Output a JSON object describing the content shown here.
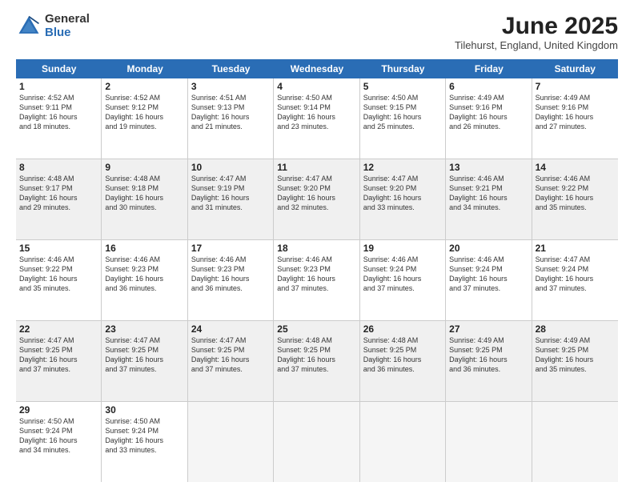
{
  "header": {
    "logo_general": "General",
    "logo_blue": "Blue",
    "month_title": "June 2025",
    "location": "Tilehurst, England, United Kingdom"
  },
  "days_of_week": [
    "Sunday",
    "Monday",
    "Tuesday",
    "Wednesday",
    "Thursday",
    "Friday",
    "Saturday"
  ],
  "rows": [
    [
      {
        "day": "1",
        "sunrise": "4:52 AM",
        "sunset": "9:11 PM",
        "daylight": "16 hours and 18 minutes."
      },
      {
        "day": "2",
        "sunrise": "4:52 AM",
        "sunset": "9:12 PM",
        "daylight": "16 hours and 19 minutes."
      },
      {
        "day": "3",
        "sunrise": "4:51 AM",
        "sunset": "9:13 PM",
        "daylight": "16 hours and 21 minutes."
      },
      {
        "day": "4",
        "sunrise": "4:50 AM",
        "sunset": "9:14 PM",
        "daylight": "16 hours and 23 minutes."
      },
      {
        "day": "5",
        "sunrise": "4:50 AM",
        "sunset": "9:15 PM",
        "daylight": "16 hours and 25 minutes."
      },
      {
        "day": "6",
        "sunrise": "4:49 AM",
        "sunset": "9:16 PM",
        "daylight": "16 hours and 26 minutes."
      },
      {
        "day": "7",
        "sunrise": "4:49 AM",
        "sunset": "9:16 PM",
        "daylight": "16 hours and 27 minutes."
      }
    ],
    [
      {
        "day": "8",
        "sunrise": "4:48 AM",
        "sunset": "9:17 PM",
        "daylight": "16 hours and 29 minutes."
      },
      {
        "day": "9",
        "sunrise": "4:48 AM",
        "sunset": "9:18 PM",
        "daylight": "16 hours and 30 minutes."
      },
      {
        "day": "10",
        "sunrise": "4:47 AM",
        "sunset": "9:19 PM",
        "daylight": "16 hours and 31 minutes."
      },
      {
        "day": "11",
        "sunrise": "4:47 AM",
        "sunset": "9:20 PM",
        "daylight": "16 hours and 32 minutes."
      },
      {
        "day": "12",
        "sunrise": "4:47 AM",
        "sunset": "9:20 PM",
        "daylight": "16 hours and 33 minutes."
      },
      {
        "day": "13",
        "sunrise": "4:46 AM",
        "sunset": "9:21 PM",
        "daylight": "16 hours and 34 minutes."
      },
      {
        "day": "14",
        "sunrise": "4:46 AM",
        "sunset": "9:22 PM",
        "daylight": "16 hours and 35 minutes."
      }
    ],
    [
      {
        "day": "15",
        "sunrise": "4:46 AM",
        "sunset": "9:22 PM",
        "daylight": "16 hours and 35 minutes."
      },
      {
        "day": "16",
        "sunrise": "4:46 AM",
        "sunset": "9:23 PM",
        "daylight": "16 hours and 36 minutes."
      },
      {
        "day": "17",
        "sunrise": "4:46 AM",
        "sunset": "9:23 PM",
        "daylight": "16 hours and 36 minutes."
      },
      {
        "day": "18",
        "sunrise": "4:46 AM",
        "sunset": "9:23 PM",
        "daylight": "16 hours and 37 minutes."
      },
      {
        "day": "19",
        "sunrise": "4:46 AM",
        "sunset": "9:24 PM",
        "daylight": "16 hours and 37 minutes."
      },
      {
        "day": "20",
        "sunrise": "4:46 AM",
        "sunset": "9:24 PM",
        "daylight": "16 hours and 37 minutes."
      },
      {
        "day": "21",
        "sunrise": "4:47 AM",
        "sunset": "9:24 PM",
        "daylight": "16 hours and 37 minutes."
      }
    ],
    [
      {
        "day": "22",
        "sunrise": "4:47 AM",
        "sunset": "9:25 PM",
        "daylight": "16 hours and 37 minutes."
      },
      {
        "day": "23",
        "sunrise": "4:47 AM",
        "sunset": "9:25 PM",
        "daylight": "16 hours and 37 minutes."
      },
      {
        "day": "24",
        "sunrise": "4:47 AM",
        "sunset": "9:25 PM",
        "daylight": "16 hours and 37 minutes."
      },
      {
        "day": "25",
        "sunrise": "4:48 AM",
        "sunset": "9:25 PM",
        "daylight": "16 hours and 37 minutes."
      },
      {
        "day": "26",
        "sunrise": "4:48 AM",
        "sunset": "9:25 PM",
        "daylight": "16 hours and 36 minutes."
      },
      {
        "day": "27",
        "sunrise": "4:49 AM",
        "sunset": "9:25 PM",
        "daylight": "16 hours and 36 minutes."
      },
      {
        "day": "28",
        "sunrise": "4:49 AM",
        "sunset": "9:25 PM",
        "daylight": "16 hours and 35 minutes."
      }
    ],
    [
      {
        "day": "29",
        "sunrise": "4:50 AM",
        "sunset": "9:24 PM",
        "daylight": "16 hours and 34 minutes."
      },
      {
        "day": "30",
        "sunrise": "4:50 AM",
        "sunset": "9:24 PM",
        "daylight": "16 hours and 33 minutes."
      },
      {
        "day": "",
        "sunrise": "",
        "sunset": "",
        "daylight": ""
      },
      {
        "day": "",
        "sunrise": "",
        "sunset": "",
        "daylight": ""
      },
      {
        "day": "",
        "sunrise": "",
        "sunset": "",
        "daylight": ""
      },
      {
        "day": "",
        "sunrise": "",
        "sunset": "",
        "daylight": ""
      },
      {
        "day": "",
        "sunrise": "",
        "sunset": "",
        "daylight": ""
      }
    ]
  ],
  "labels": {
    "sunrise": "Sunrise:",
    "sunset": "Sunset:",
    "daylight": "Daylight:"
  }
}
